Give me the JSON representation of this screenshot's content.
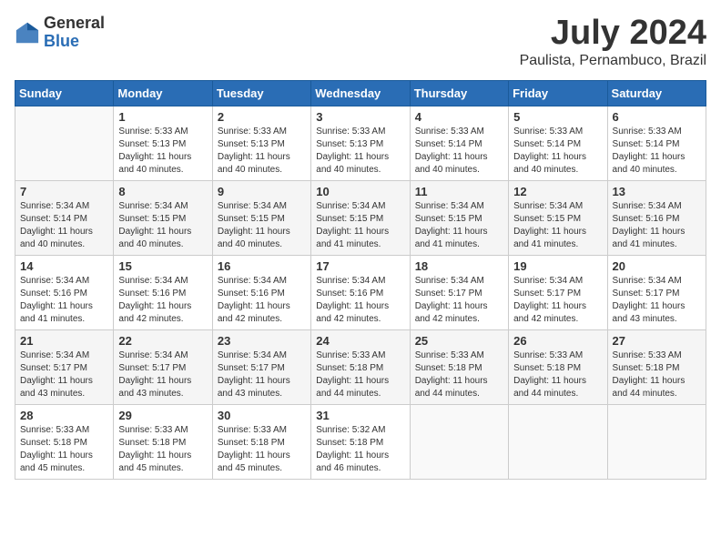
{
  "header": {
    "logo_general": "General",
    "logo_blue": "Blue",
    "month_title": "July 2024",
    "location": "Paulista, Pernambuco, Brazil"
  },
  "days_of_week": [
    "Sunday",
    "Monday",
    "Tuesday",
    "Wednesday",
    "Thursday",
    "Friday",
    "Saturday"
  ],
  "weeks": [
    [
      {
        "day": "",
        "info": ""
      },
      {
        "day": "1",
        "info": "Sunrise: 5:33 AM\nSunset: 5:13 PM\nDaylight: 11 hours\nand 40 minutes."
      },
      {
        "day": "2",
        "info": "Sunrise: 5:33 AM\nSunset: 5:13 PM\nDaylight: 11 hours\nand 40 minutes."
      },
      {
        "day": "3",
        "info": "Sunrise: 5:33 AM\nSunset: 5:13 PM\nDaylight: 11 hours\nand 40 minutes."
      },
      {
        "day": "4",
        "info": "Sunrise: 5:33 AM\nSunset: 5:14 PM\nDaylight: 11 hours\nand 40 minutes."
      },
      {
        "day": "5",
        "info": "Sunrise: 5:33 AM\nSunset: 5:14 PM\nDaylight: 11 hours\nand 40 minutes."
      },
      {
        "day": "6",
        "info": "Sunrise: 5:33 AM\nSunset: 5:14 PM\nDaylight: 11 hours\nand 40 minutes."
      }
    ],
    [
      {
        "day": "7",
        "info": "Sunrise: 5:34 AM\nSunset: 5:14 PM\nDaylight: 11 hours\nand 40 minutes."
      },
      {
        "day": "8",
        "info": "Sunrise: 5:34 AM\nSunset: 5:15 PM\nDaylight: 11 hours\nand 40 minutes."
      },
      {
        "day": "9",
        "info": "Sunrise: 5:34 AM\nSunset: 5:15 PM\nDaylight: 11 hours\nand 40 minutes."
      },
      {
        "day": "10",
        "info": "Sunrise: 5:34 AM\nSunset: 5:15 PM\nDaylight: 11 hours\nand 41 minutes."
      },
      {
        "day": "11",
        "info": "Sunrise: 5:34 AM\nSunset: 5:15 PM\nDaylight: 11 hours\nand 41 minutes."
      },
      {
        "day": "12",
        "info": "Sunrise: 5:34 AM\nSunset: 5:15 PM\nDaylight: 11 hours\nand 41 minutes."
      },
      {
        "day": "13",
        "info": "Sunrise: 5:34 AM\nSunset: 5:16 PM\nDaylight: 11 hours\nand 41 minutes."
      }
    ],
    [
      {
        "day": "14",
        "info": "Sunrise: 5:34 AM\nSunset: 5:16 PM\nDaylight: 11 hours\nand 41 minutes."
      },
      {
        "day": "15",
        "info": "Sunrise: 5:34 AM\nSunset: 5:16 PM\nDaylight: 11 hours\nand 42 minutes."
      },
      {
        "day": "16",
        "info": "Sunrise: 5:34 AM\nSunset: 5:16 PM\nDaylight: 11 hours\nand 42 minutes."
      },
      {
        "day": "17",
        "info": "Sunrise: 5:34 AM\nSunset: 5:16 PM\nDaylight: 11 hours\nand 42 minutes."
      },
      {
        "day": "18",
        "info": "Sunrise: 5:34 AM\nSunset: 5:17 PM\nDaylight: 11 hours\nand 42 minutes."
      },
      {
        "day": "19",
        "info": "Sunrise: 5:34 AM\nSunset: 5:17 PM\nDaylight: 11 hours\nand 42 minutes."
      },
      {
        "day": "20",
        "info": "Sunrise: 5:34 AM\nSunset: 5:17 PM\nDaylight: 11 hours\nand 43 minutes."
      }
    ],
    [
      {
        "day": "21",
        "info": "Sunrise: 5:34 AM\nSunset: 5:17 PM\nDaylight: 11 hours\nand 43 minutes."
      },
      {
        "day": "22",
        "info": "Sunrise: 5:34 AM\nSunset: 5:17 PM\nDaylight: 11 hours\nand 43 minutes."
      },
      {
        "day": "23",
        "info": "Sunrise: 5:34 AM\nSunset: 5:17 PM\nDaylight: 11 hours\nand 43 minutes."
      },
      {
        "day": "24",
        "info": "Sunrise: 5:33 AM\nSunset: 5:18 PM\nDaylight: 11 hours\nand 44 minutes."
      },
      {
        "day": "25",
        "info": "Sunrise: 5:33 AM\nSunset: 5:18 PM\nDaylight: 11 hours\nand 44 minutes."
      },
      {
        "day": "26",
        "info": "Sunrise: 5:33 AM\nSunset: 5:18 PM\nDaylight: 11 hours\nand 44 minutes."
      },
      {
        "day": "27",
        "info": "Sunrise: 5:33 AM\nSunset: 5:18 PM\nDaylight: 11 hours\nand 44 minutes."
      }
    ],
    [
      {
        "day": "28",
        "info": "Sunrise: 5:33 AM\nSunset: 5:18 PM\nDaylight: 11 hours\nand 45 minutes."
      },
      {
        "day": "29",
        "info": "Sunrise: 5:33 AM\nSunset: 5:18 PM\nDaylight: 11 hours\nand 45 minutes."
      },
      {
        "day": "30",
        "info": "Sunrise: 5:33 AM\nSunset: 5:18 PM\nDaylight: 11 hours\nand 45 minutes."
      },
      {
        "day": "31",
        "info": "Sunrise: 5:32 AM\nSunset: 5:18 PM\nDaylight: 11 hours\nand 46 minutes."
      },
      {
        "day": "",
        "info": ""
      },
      {
        "day": "",
        "info": ""
      },
      {
        "day": "",
        "info": ""
      }
    ]
  ]
}
